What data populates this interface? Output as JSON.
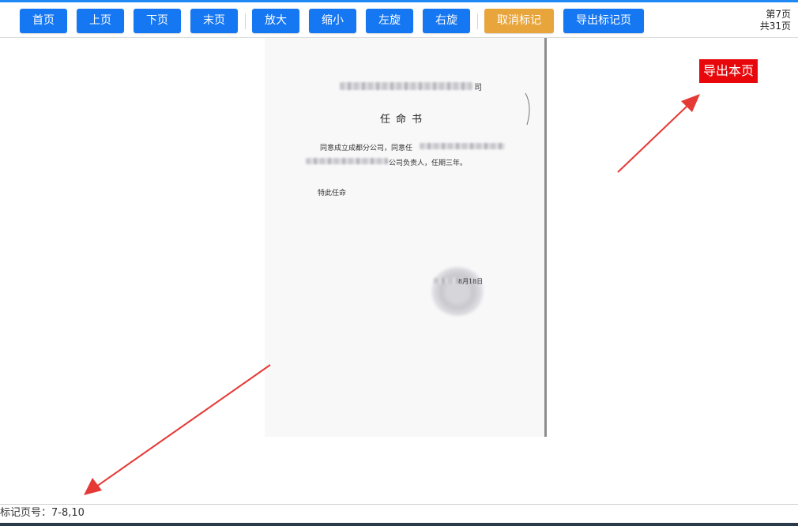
{
  "toolbar": {
    "first_page": "首页",
    "prev_page": "上页",
    "next_page": "下页",
    "last_page": "末页",
    "zoom_in": "放大",
    "zoom_out": "缩小",
    "rotate_left": "左旋",
    "rotate_right": "右旋",
    "cancel_mark": "取消标记",
    "export_marked": "导出标记页"
  },
  "page_info": {
    "current": "第7页",
    "total": "共31页"
  },
  "document": {
    "company_suffix": "司",
    "title": "任命书",
    "line1_prefix": "同意成立成都分公司，同意任",
    "line2_suffix": "公司负责人，任期三年。",
    "closing": "特此任命",
    "stamp_date": "8月18日"
  },
  "export_page_label": "导出本页",
  "status": {
    "marked_pages": "标记页号：7-8,10"
  },
  "colors": {
    "primary_button": "#1677f2",
    "mark_button": "#e8a53c",
    "export_button": "#e8080b",
    "arrow": "#e53935"
  }
}
